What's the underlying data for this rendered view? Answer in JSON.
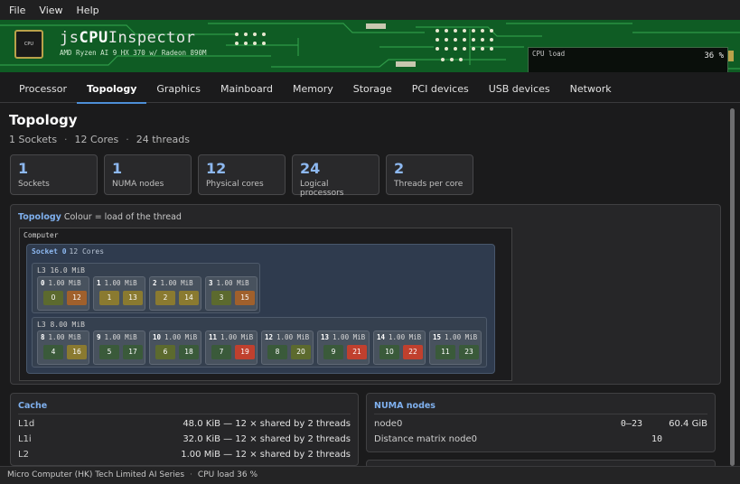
{
  "menu": [
    "File",
    "View",
    "Help"
  ],
  "banner": {
    "title_prefix": "js",
    "title_bold": "CPU",
    "title_suffix": "Inspector",
    "cpu_name": "AMD Ryzen AI 9 HX 370 w/ Radeon 890M",
    "chip_label": "CPU",
    "cpu_load_label": "CPU load",
    "cpu_load_value": "36 %",
    "cpu_load_fraction": 0.36
  },
  "tabs": [
    "Processor",
    "Topology",
    "Graphics",
    "Mainboard",
    "Memory",
    "Storage",
    "PCI devices",
    "USB devices",
    "Network"
  ],
  "active_tab": "Topology",
  "page": {
    "title": "Topology",
    "summary": [
      "1 Sockets",
      "12 Cores",
      "24 threads"
    ]
  },
  "stats": [
    {
      "value": "1",
      "label": "Sockets"
    },
    {
      "value": "1",
      "label": "NUMA nodes"
    },
    {
      "value": "12",
      "label": "Physical cores"
    },
    {
      "value": "24",
      "label": "Logical processors"
    },
    {
      "value": "2",
      "label": "Threads per core"
    }
  ],
  "topology": {
    "heading": "Topology",
    "caption": "Colour = load of the thread",
    "computer_label": "Computer",
    "socket_label": "Socket 0",
    "socket_cores": "12 Cores",
    "load_colors": {
      "idle": "#3a5a3a",
      "low": "#5c6a2e",
      "mid": "#8a7a30",
      "warm": "#a0602c",
      "hot": "#c0402e"
    },
    "l3_groups": [
      {
        "label": "L3  16.0 MiB",
        "cores": [
          {
            "id": "0",
            "cache": "1.00 MiB",
            "threads": [
              {
                "n": "0",
                "load": "low"
              },
              {
                "n": "12",
                "load": "warm"
              }
            ]
          },
          {
            "id": "1",
            "cache": "1.00 MiB",
            "threads": [
              {
                "n": "1",
                "load": "mid"
              },
              {
                "n": "13",
                "load": "mid"
              }
            ]
          },
          {
            "id": "2",
            "cache": "1.00 MiB",
            "threads": [
              {
                "n": "2",
                "load": "mid"
              },
              {
                "n": "14",
                "load": "mid"
              }
            ]
          },
          {
            "id": "3",
            "cache": "1.00 MiB",
            "threads": [
              {
                "n": "3",
                "load": "low"
              },
              {
                "n": "15",
                "load": "warm"
              }
            ]
          }
        ]
      },
      {
        "label": "L3  8.00 MiB",
        "cores": [
          {
            "id": "8",
            "cache": "1.00 MiB",
            "threads": [
              {
                "n": "4",
                "load": "idle"
              },
              {
                "n": "16",
                "load": "mid"
              }
            ]
          },
          {
            "id": "9",
            "cache": "1.00 MiB",
            "threads": [
              {
                "n": "5",
                "load": "idle"
              },
              {
                "n": "17",
                "load": "idle"
              }
            ]
          },
          {
            "id": "10",
            "cache": "1.00 MiB",
            "threads": [
              {
                "n": "6",
                "load": "low"
              },
              {
                "n": "18",
                "load": "idle"
              }
            ]
          },
          {
            "id": "11",
            "cache": "1.00 MiB",
            "threads": [
              {
                "n": "7",
                "load": "idle"
              },
              {
                "n": "19",
                "load": "hot"
              }
            ]
          },
          {
            "id": "12",
            "cache": "1.00 MiB",
            "threads": [
              {
                "n": "8",
                "load": "idle"
              },
              {
                "n": "20",
                "load": "low"
              }
            ]
          },
          {
            "id": "13",
            "cache": "1.00 MiB",
            "threads": [
              {
                "n": "9",
                "load": "idle"
              },
              {
                "n": "21",
                "load": "hot"
              }
            ]
          },
          {
            "id": "14",
            "cache": "1.00 MiB",
            "threads": [
              {
                "n": "10",
                "load": "idle"
              },
              {
                "n": "22",
                "load": "hot"
              }
            ]
          },
          {
            "id": "15",
            "cache": "1.00 MiB",
            "threads": [
              {
                "n": "11",
                "load": "idle"
              },
              {
                "n": "23",
                "load": "idle"
              }
            ]
          }
        ]
      }
    ]
  },
  "cache": {
    "heading": "Cache",
    "rows": [
      {
        "k": "L1d",
        "v": "48.0 KiB  —  12 × shared by 2 threads"
      },
      {
        "k": "L1i",
        "v": "32.0 KiB  —  12 × shared by 2 threads"
      },
      {
        "k": "L2",
        "v": "1.00 MiB  —  12 × shared by 2 threads"
      }
    ]
  },
  "numa": {
    "heading": "NUMA nodes",
    "node_label": "node0",
    "node_cpus": "0–23",
    "node_mem": "60.4 GiB",
    "dist_label": "Distance matrix node0",
    "dist_value": "10"
  },
  "status": {
    "vendor": "Micro Computer (HK) Tech Limited AI Series",
    "load": "CPU load 36 %"
  }
}
